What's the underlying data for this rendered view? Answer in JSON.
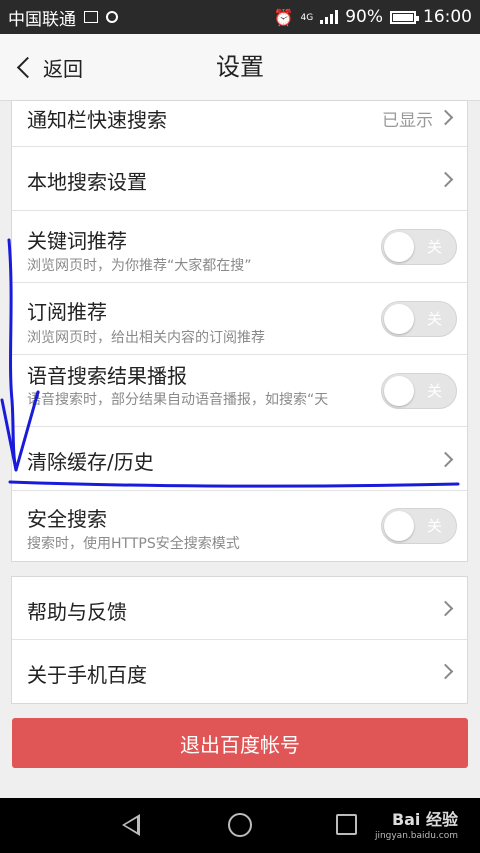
{
  "status_bar": {
    "carrier": "中国联通",
    "network": "4G",
    "battery": "90%",
    "battery_level": 0.9,
    "time": "16:00"
  },
  "header": {
    "back_label": "返回",
    "title": "设置"
  },
  "settings": [
    {
      "label": "通知栏快速搜索",
      "value": "已显示"
    },
    {
      "label": "本地搜索设置"
    },
    {
      "label": "关键词推荐",
      "sub": "浏览网页时，为你推荐“大家都在搜”",
      "toggle": "关"
    },
    {
      "label": "订阅推荐",
      "sub": "浏览网页时，给出相关内容的订阅推荐",
      "toggle": "关"
    },
    {
      "label": "语音搜索结果播报",
      "sub": "语音搜索时，部分结果自动语音播报，如搜索“天",
      "toggle": "关"
    },
    {
      "label": "清除缓存/历史"
    },
    {
      "label": "安全搜索",
      "sub": "搜索时，使用HTTPS安全搜索模式",
      "toggle": "关"
    }
  ],
  "more": [
    {
      "label": "帮助与反馈"
    },
    {
      "label": "关于手机百度"
    }
  ],
  "logout_label": "退出百度帐号",
  "watermark": {
    "brand": "Bai 经验",
    "url": "jingyan.baidu.com"
  },
  "colors": {
    "logout": "#e05555",
    "annotation": "#1a1adb"
  }
}
